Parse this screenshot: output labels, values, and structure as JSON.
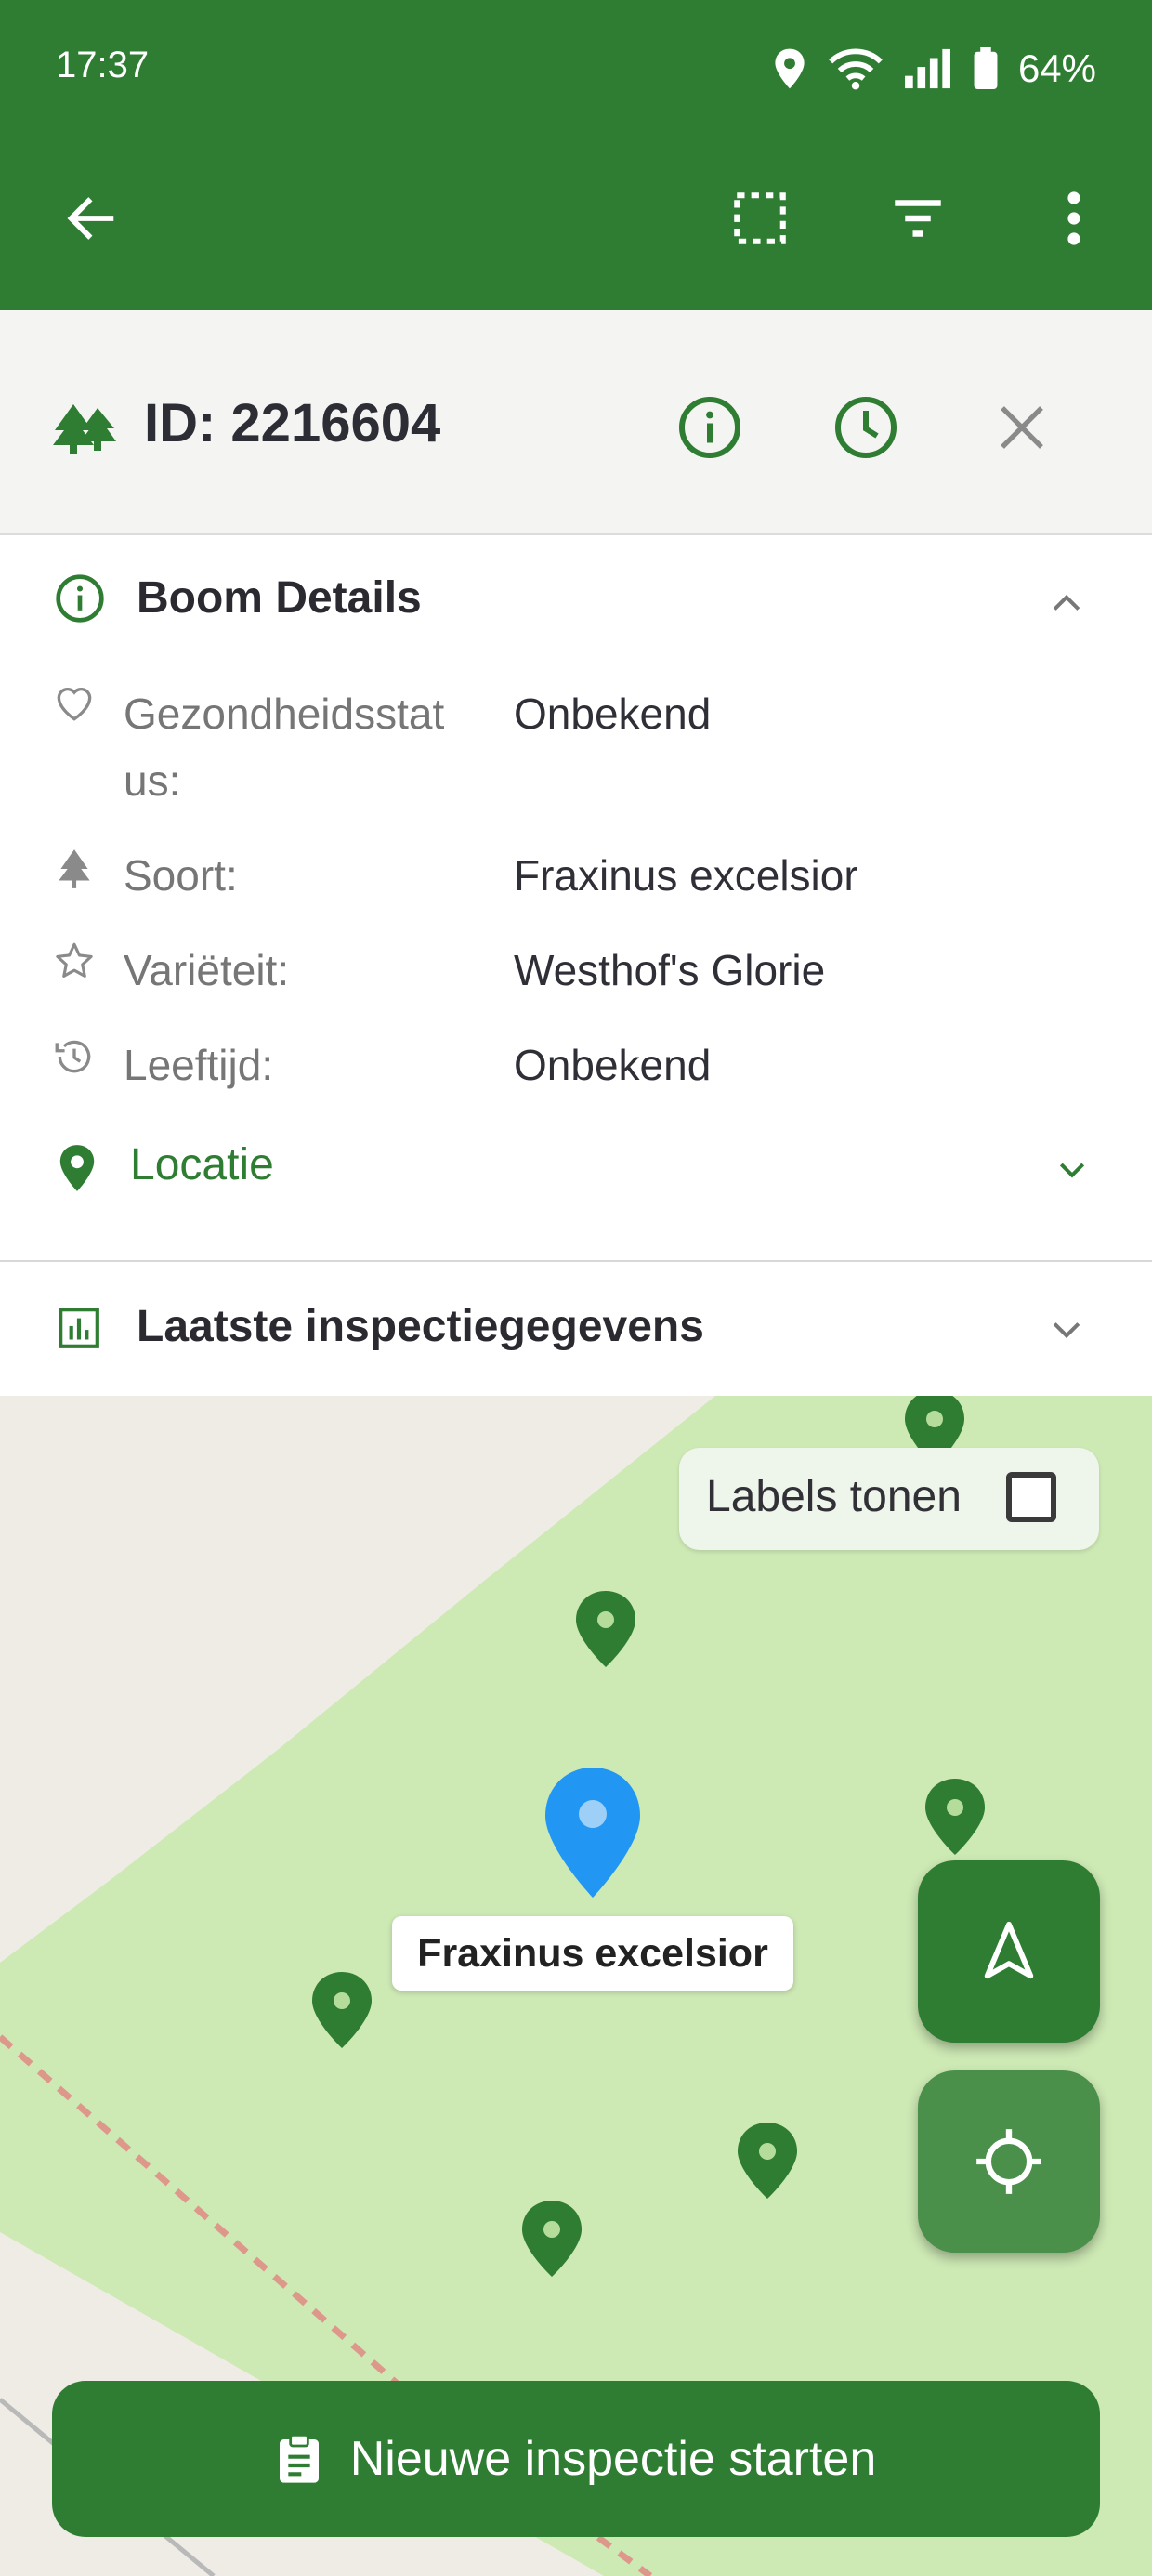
{
  "status_bar": {
    "time": "17:37",
    "battery": "64%"
  },
  "header": {
    "id_text": "ID: 2216604"
  },
  "details": {
    "title": "Boom Details",
    "rows": [
      {
        "label": "Gezondheidsstat",
        "label_cont": "us:",
        "value": "Onbekend"
      },
      {
        "label": "Soort:",
        "value": "Fraxinus excelsior"
      },
      {
        "label": "Variëteit:",
        "value": "Westhof's Glorie"
      },
      {
        "label": "Leeftijd:",
        "value": "Onbekend"
      }
    ],
    "location_label": "Locatie"
  },
  "inspection": {
    "title": "Laatste inspectiegegevens"
  },
  "map": {
    "labels_toggle": "Labels tonen",
    "selected_tree_label": "Fraxinus excelsior"
  },
  "actions": {
    "start_inspection": "Nieuwe inspectie starten"
  },
  "colors": {
    "primary": "#2e7d32",
    "selected_pin": "#2196f3",
    "park": "#cde9b4"
  }
}
